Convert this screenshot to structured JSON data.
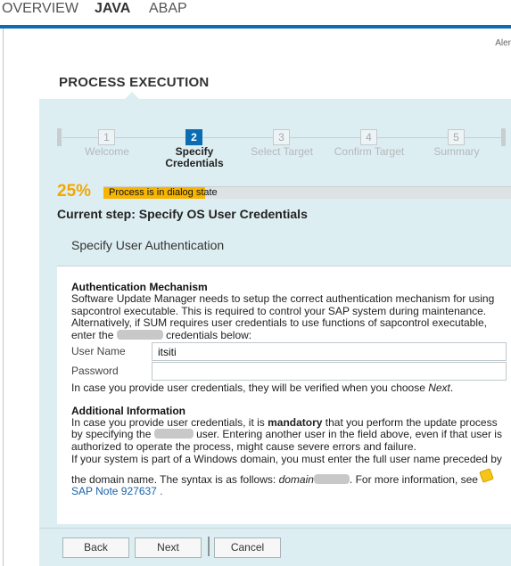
{
  "tabs": [
    {
      "label": "OVERVIEW",
      "active": false
    },
    {
      "label": "JAVA",
      "active": true
    },
    {
      "label": "ABAP",
      "active": false
    }
  ],
  "alert_text": "Aler",
  "section_title": "PROCESS EXECUTION",
  "roadmap": {
    "steps": [
      {
        "number": "1",
        "label": "Welcome",
        "active": false
      },
      {
        "number": "2",
        "label_line1": "Specify",
        "label_line2": "Credentials",
        "active": true
      },
      {
        "number": "3",
        "label": "Select Target",
        "active": false
      },
      {
        "number": "4",
        "label": "Confirm Target",
        "active": false
      },
      {
        "number": "5",
        "label": "Summary",
        "active": false
      }
    ]
  },
  "progress": {
    "percent_text": "25%",
    "fraction": 0.25,
    "status_text": "Process is in dialog state"
  },
  "current_step": "Current step: Specify OS User Credentials",
  "dialog": {
    "title": "Specify User Authentication",
    "auth": {
      "heading": "Authentication Mechanism",
      "text_1": "Software Update Manager needs to setup the correct authentication mechanism for using sapcontrol executable. This is required to control your SAP system during maintenance. Alternatively, if SUM requires user credentials to use functions of sapcontrol executable,",
      "text_2a": "enter the",
      "text_2b": "credentials below:"
    },
    "fields": {
      "username_label": "User Name",
      "username_value": "itsiti",
      "password_label": "Password",
      "password_value": ""
    },
    "verify_note_a": "In case you provide user credentials, they will be verified when you choose ",
    "verify_note_b": "Next",
    "verify_note_c": ".",
    "additional": {
      "heading": "Additional Information",
      "p1a": "In case you provide user credentials, it is ",
      "p1b": "mandatory",
      "p1c": " that you perform the update process",
      "p2a": "by specifying the",
      "p2b": "user. Entering another user in the field above, even if that user is",
      "p3": "authorized to operate the process, might cause severe errors and failure.",
      "p4": "If your system is part of a Windows domain, you must enter the full user name preceded by",
      "p5a": "the domain name. The syntax is as follows: ",
      "p5b": "domain",
      "p5c": ". For more information, see",
      "link": "SAP Note 927637",
      "link_suffix": " ."
    }
  },
  "buttons": {
    "back": "Back",
    "next": "Next",
    "cancel": "Cancel"
  }
}
